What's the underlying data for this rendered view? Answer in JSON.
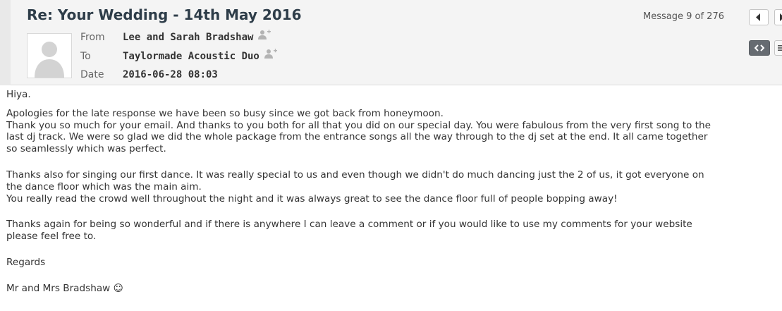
{
  "message": {
    "subject": "Re: Your Wedding - 14th May 2016",
    "counter": "Message 9 of 276",
    "headers": {
      "from_label": "From",
      "from_value": "Lee and Sarah Bradshaw",
      "to_label": "To",
      "to_value": "Taylormade Acoustic Duo",
      "date_label": "Date",
      "date_value": "2016-06-28 08:03"
    },
    "body": {
      "greeting": "Hiya.",
      "p1_l1": "Apologies for the late response we have been so busy since we got back from honeymoon.",
      "p1_l2": "Thank you so much for your email. And thanks to you both for all that you did on our special day. You were fabulous from the very first song to the",
      "p1_l3": "last dj track. We were so glad we did the whole package from the entrance songs all the way through to the dj set at the end. It all came together",
      "p1_l4": "so seamlessly which was perfect.",
      "p2_l1": "Thanks also for singing our first dance. It was really special to us and even though we didn't do much dancing just the 2 of us, it got everyone on",
      "p2_l2": "the dance floor which was the main aim.",
      "p2_l3": "You really read the crowd well throughout the night and it was always great to see the dance floor full of people bopping away!",
      "p3_l1": "Thanks again for being so wonderful and if there is anywhere I can leave a comment or if you would like to use my comments for your website",
      "p3_l2": "please feel free to.",
      "regards": "Regards",
      "signature": "Mr and Mrs Bradshaw ☺"
    }
  },
  "icons": {
    "prev": "prev-message-icon",
    "next": "next-message-icon",
    "html_view": "html-view-icon",
    "plain_view": "plain-view-icon",
    "avatar": "contact-avatar-icon",
    "add_contact": "add-contact-icon"
  },
  "colors": {
    "header_bg": "#f4f4f4",
    "subject": "#2e3d49",
    "active_toggle": "#666b71"
  }
}
